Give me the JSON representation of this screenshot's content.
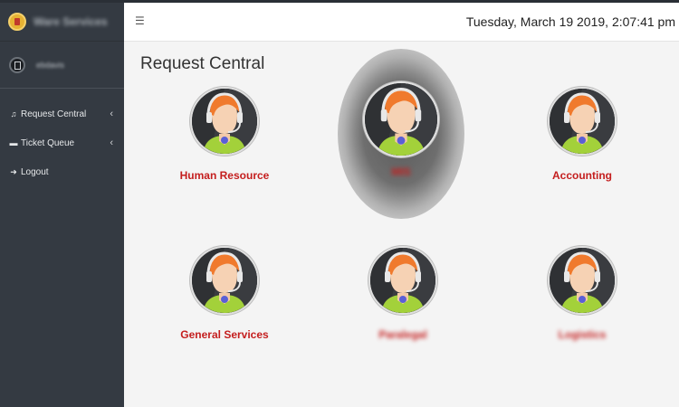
{
  "topbar": {
    "datetime": "Tuesday, March 19 2019, 2:07:41 pm",
    "menu_icon": "hamburger-icon"
  },
  "sidebar": {
    "brand": "Ware Services",
    "user": "ebdavis",
    "items": [
      {
        "label": "Request Central",
        "icon": "music-icon",
        "has_caret": true
      },
      {
        "label": "Ticket Queue",
        "icon": "ticket-icon",
        "has_caret": true
      },
      {
        "label": "Logout",
        "icon": "logout-icon",
        "has_caret": false
      }
    ]
  },
  "main": {
    "title": "Request Central",
    "tiles": [
      {
        "label": "Human Resource"
      },
      {
        "label": "MIS"
      },
      {
        "label": "Accounting"
      },
      {
        "label": "General Services"
      },
      {
        "label": "Paralegal"
      },
      {
        "label": "Logistics"
      }
    ]
  },
  "colors": {
    "label_red": "#c41e1e",
    "sidebar_bg": "#343a42"
  }
}
